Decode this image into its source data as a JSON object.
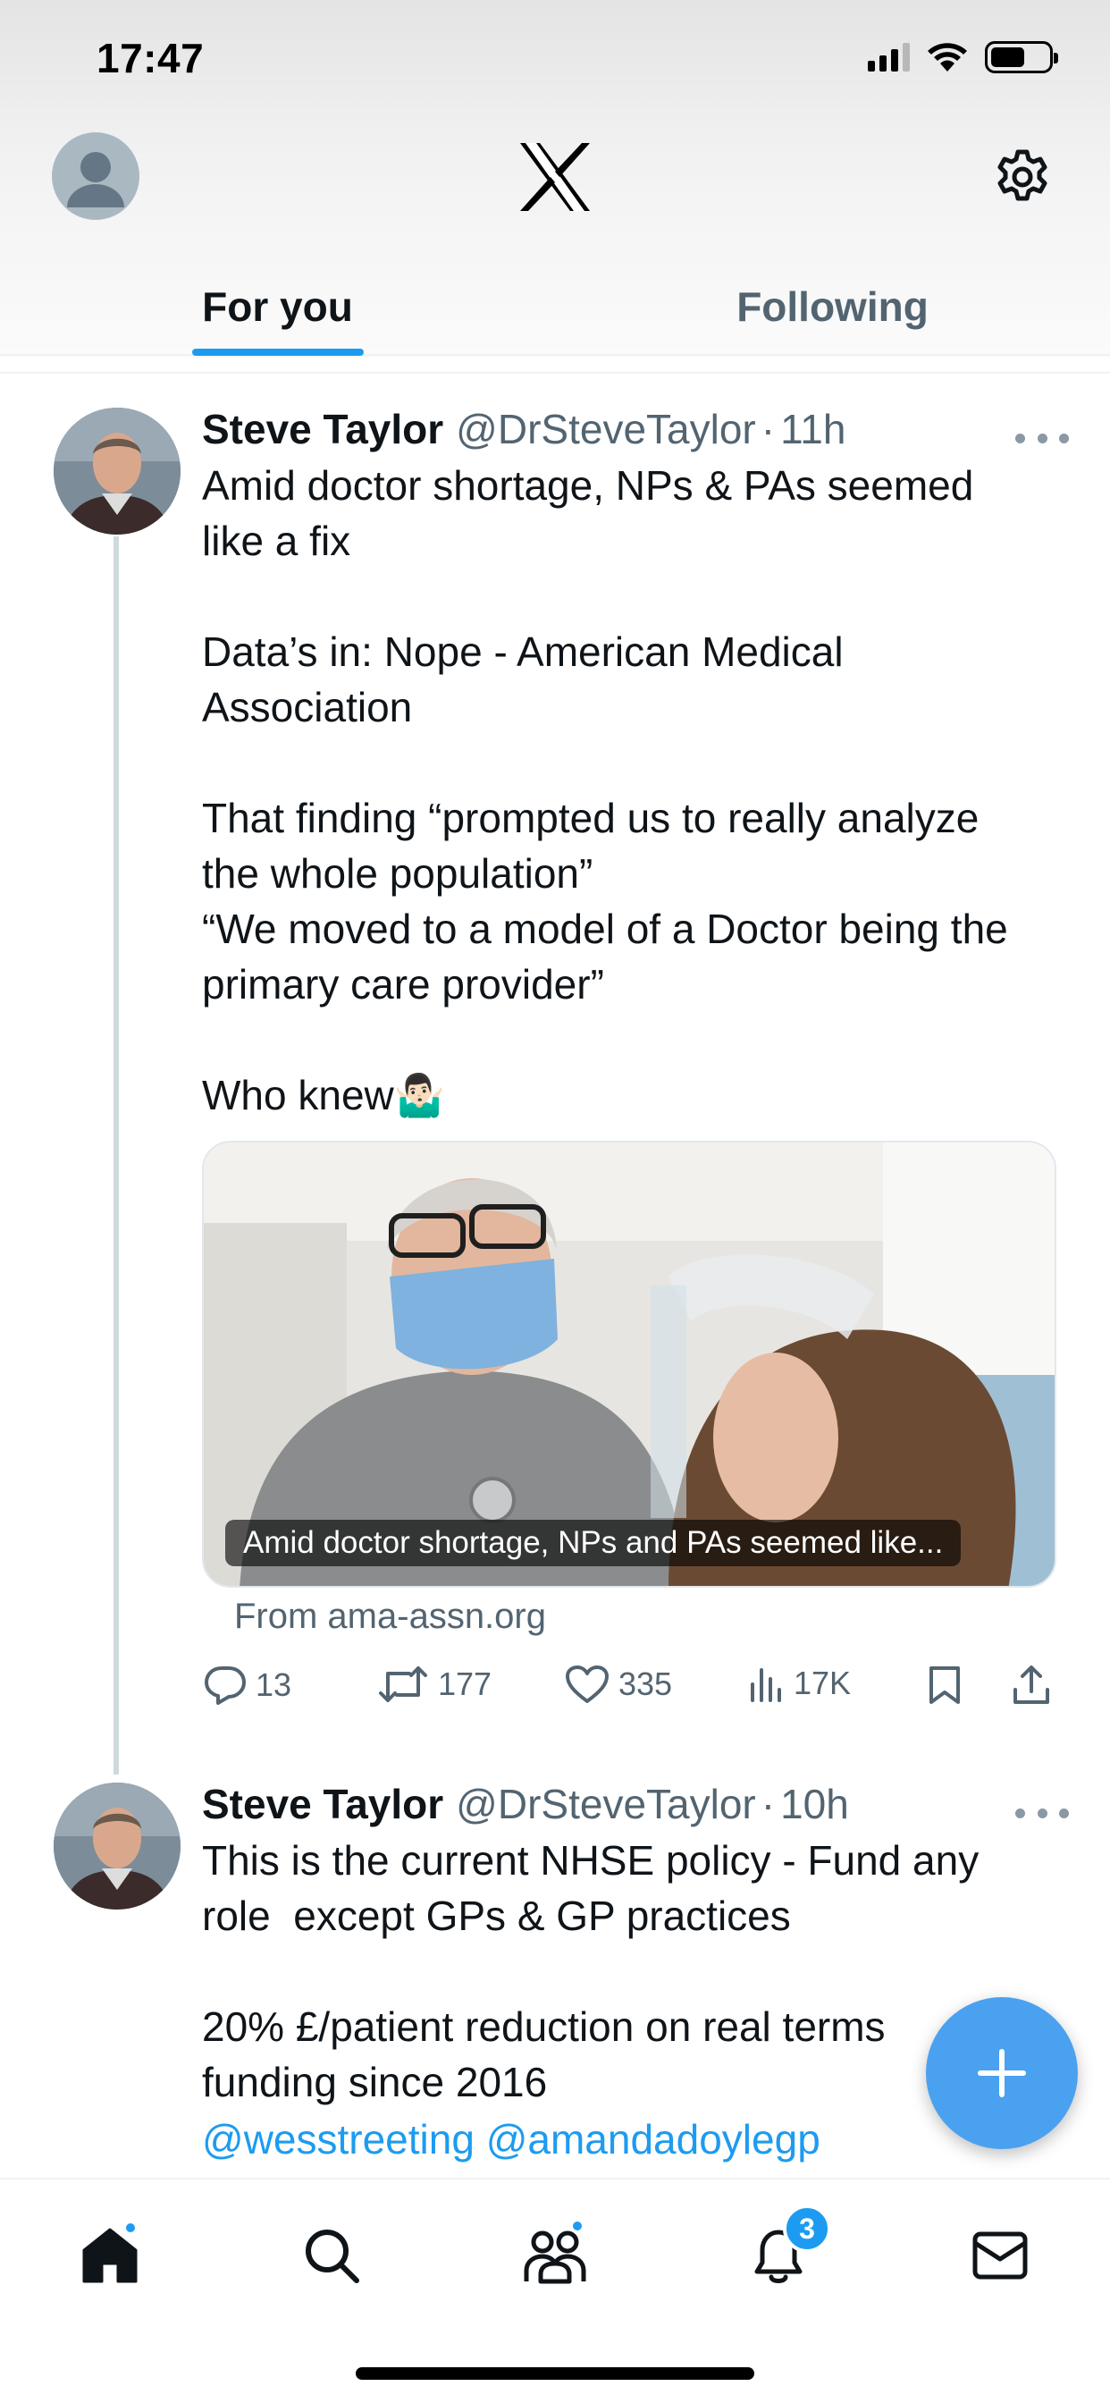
{
  "status_bar": {
    "time": "17:47"
  },
  "tabs": [
    {
      "label": "For you",
      "active": true
    },
    {
      "label": "Following",
      "active": false
    }
  ],
  "posts": [
    {
      "author_name": "Steve Taylor",
      "handle": "@DrSteveTaylor",
      "separator": "·",
      "time": "11h",
      "text": "Amid doctor shortage, NPs & PAs seemed\nlike a fix\n\nData’s in: Nope - American Medical\nAssociation\n\nThat finding “prompted us to really analyze\nthe whole population”\n“We moved to a model of a Doctor being the\nprimary care provider”\n\nWho knew🤷🏻‍♂️",
      "card_caption": "Amid doctor shortage, NPs and PAs seemed like...",
      "card_source": "From ama-assn.org",
      "replies": "13",
      "reposts": "177",
      "likes": "335",
      "views": "17K"
    },
    {
      "author_name": "Steve Taylor",
      "handle": "@DrSteveTaylor",
      "separator": "·",
      "time": "10h",
      "text_line1": "This is the current NHSE policy - Fund any\nrole  except GPs & GP practices\n\n20% £/patient reduction on real terms\nfunding since 2016",
      "mentions": "@wesstreeting @amandadoylegp"
    }
  ],
  "bottom_nav": {
    "notification_count": "3"
  },
  "colors": {
    "accent": "#1d9bf0",
    "text_primary": "#0f1419",
    "text_secondary": "#536471"
  }
}
